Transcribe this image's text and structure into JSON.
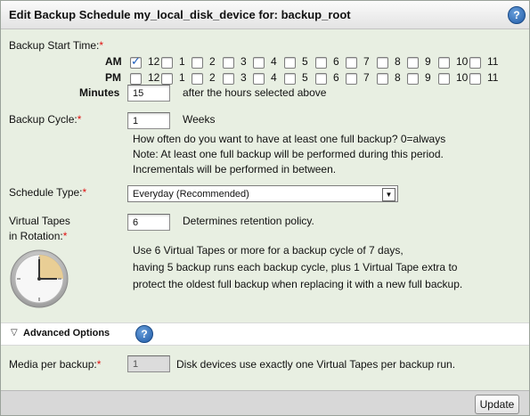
{
  "title": "Edit Backup Schedule my_local_disk_device for: backup_root",
  "help_icon": "?",
  "start_time": {
    "label": "Backup Start Time:",
    "am_label": "AM",
    "pm_label": "PM",
    "hours": [
      "12",
      "1",
      "2",
      "3",
      "4",
      "5",
      "6",
      "7",
      "8",
      "9",
      "10",
      "11"
    ],
    "am_checked": [
      true,
      false,
      false,
      false,
      false,
      false,
      false,
      false,
      false,
      false,
      false,
      false
    ],
    "pm_checked": [
      false,
      false,
      false,
      false,
      false,
      false,
      false,
      false,
      false,
      false,
      false,
      false
    ],
    "minutes_label": "Minutes",
    "minutes_value": "15",
    "minutes_hint": "after the hours selected above"
  },
  "cycle": {
    "label": "Backup Cycle:",
    "value": "1",
    "unit": "Weeks",
    "help1": "How often do you want to have at least one full backup? 0=always",
    "help2": "Note: At least one full backup will be performed during this period.",
    "help3": "Incrementals will be performed in between."
  },
  "schedule_type": {
    "label": "Schedule Type:",
    "selected": "Everyday (Recommended)"
  },
  "tapes": {
    "label1": "Virtual Tapes",
    "label2": "in Rotation:",
    "value": "6",
    "hint": "Determines retention policy.",
    "note1": "Use 6 Virtual Tapes or more for a backup cycle of 7 days,",
    "note2": "having 5 backup runs each backup cycle, plus 1 Virtual Tape extra to",
    "note3": "protect the oldest full backup when replacing it with a new full backup."
  },
  "advanced": {
    "label": "Advanced Options",
    "expanded": true
  },
  "media": {
    "label": "Media per backup:",
    "value": "1",
    "hint": "Disk devices use exactly one Virtual Tapes per backup run."
  },
  "footer": {
    "update_label": "Update"
  },
  "colors": {
    "panel_bg": "#e8efe2",
    "required": "#e01010",
    "help_icon": "#1f5aa6"
  },
  "icons": [
    "help-icon",
    "clock-icon",
    "triangle-down-icon",
    "checkbox-check-icon"
  ]
}
